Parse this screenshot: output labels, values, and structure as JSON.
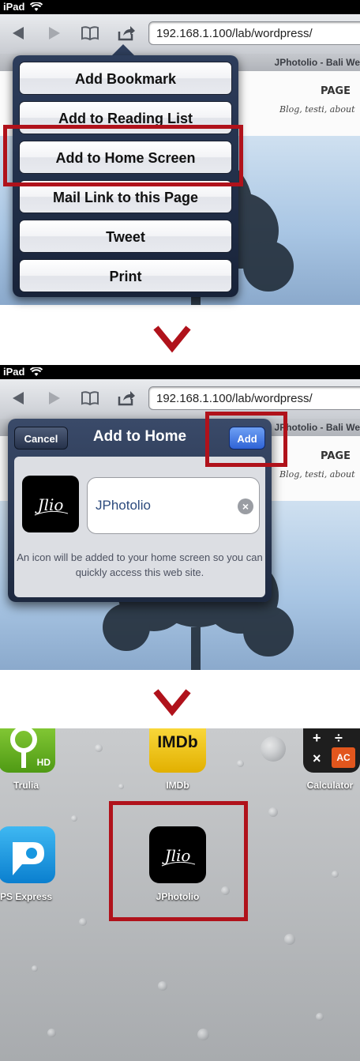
{
  "status": {
    "carrier": "iPad"
  },
  "browser": {
    "url": "192.168.1.100/lab/wordpress/",
    "tab_title": "JPhotolio - Bali We",
    "page_label": "PAGE",
    "tagline": "Blog, testi, about"
  },
  "share_menu": {
    "items": [
      {
        "label": "Add Bookmark"
      },
      {
        "label": "Add to Reading List"
      },
      {
        "label": "Add to Home Screen"
      },
      {
        "label": "Mail Link to this Page"
      },
      {
        "label": "Tweet"
      },
      {
        "label": "Print"
      }
    ]
  },
  "add_dialog": {
    "title": "Add to Home",
    "cancel_label": "Cancel",
    "add_label": "Add",
    "name_value": "JPhotolio",
    "icon_text": "Jlio",
    "note": "An icon will be added to your home screen so you can quickly access this web site."
  },
  "home_screen": {
    "apps": [
      {
        "label": "Trulia",
        "badge": "HD"
      },
      {
        "label": "IMDb",
        "badge": "IMDb"
      },
      {
        "label": "Calculator",
        "badge": "AC"
      },
      {
        "label": "PS Express"
      },
      {
        "label": "JPhotolio",
        "badge": "Jlio"
      }
    ]
  },
  "colors": {
    "highlight": "#b0121b",
    "add_button": "#2f63d6"
  }
}
